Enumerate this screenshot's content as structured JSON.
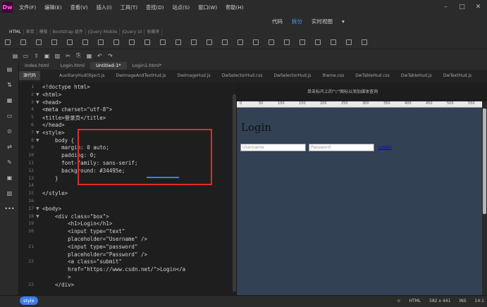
{
  "app": {
    "logo": "Dw"
  },
  "menu": [
    "文件(F)",
    "编辑(E)",
    "查看(V)",
    "插入(I)",
    "工具(T)",
    "查找(D)",
    "站点(S)",
    "窗口(W)",
    "帮助(H)"
  ],
  "views": {
    "code": "代码",
    "split": "拆分",
    "live": "实时视图",
    "dropdown": "▾"
  },
  "insert_tabs": [
    "HTML",
    "表单",
    "模板",
    "Bootstrap 组件",
    "jQuery Mobile",
    "jQuery UI",
    "收藏夹"
  ],
  "doc_tabs": [
    "index.html",
    "Login.html",
    "Untitled-1*",
    "Login1.html*"
  ],
  "source_button": "源代码",
  "related_files": [
    "AuxiliaryHudObject.js",
    "DwImageAndTextHud.js",
    "DwImageHud.js",
    "DwSelectorHud.css",
    "DwSelectorHud.js",
    "theme.css",
    "DwTableHud.css",
    "DwTableHud.js",
    "DwTextHud.js"
  ],
  "code_lines": [
    {
      "n": "1",
      "text": "<!doctype html>"
    },
    {
      "n": "2",
      "text": "<html>"
    },
    {
      "n": "3",
      "text": "<head>"
    },
    {
      "n": "4",
      "text": "<meta charset=\"utf-8\">"
    },
    {
      "n": "5",
      "text": "<title>登录页</title>"
    },
    {
      "n": "6",
      "text": "</head>"
    },
    {
      "n": "7",
      "text": "<style>"
    },
    {
      "n": "8",
      "text": "    body {"
    },
    {
      "n": "9",
      "text": "      margin: 0 auto;"
    },
    {
      "n": "10",
      "text": "      padding: 0;"
    },
    {
      "n": "11",
      "text": "      font-family: sans-serif;"
    },
    {
      "n": "12",
      "text": "      background: #34495e;"
    },
    {
      "n": "13",
      "text": "    }"
    },
    {
      "n": "14",
      "text": ""
    },
    {
      "n": "15",
      "text": "</style>"
    },
    {
      "n": "16",
      "text": ""
    },
    {
      "n": "17",
      "text": "<body>"
    },
    {
      "n": "18",
      "text": "    <div class=\"box\">"
    },
    {
      "n": "19",
      "text": "        <h1>Login</h1>"
    },
    {
      "n": "20",
      "text": "        <input type=\"text\""
    },
    {
      "n": "",
      "text": "        placeholder=\"Username\" />"
    },
    {
      "n": "21",
      "text": "        <input type=\"password\""
    },
    {
      "n": "",
      "text": "        placeholder=\"Password\" />"
    },
    {
      "n": "22",
      "text": "        <a class=\"submit\""
    },
    {
      "n": "",
      "text": "        href=\"https://www.csdn.net/\">Login</a"
    },
    {
      "n": "",
      "text": "        >"
    },
    {
      "n": "23",
      "text": "    </div>"
    }
  ],
  "live": {
    "hint": "单击标尺上的\"▽\"图标以添加媒体查询",
    "ruler_ticks": [
      "0",
      "50",
      "100",
      "150",
      "200",
      "250",
      "300",
      "350",
      "400",
      "450",
      "500",
      "550"
    ],
    "title": "Login",
    "username_placeholder": "Username",
    "password_placeholder": "Password",
    "link": "Login"
  },
  "status": {
    "tag": "style",
    "language": "HTML",
    "size": "582 x 441",
    "mode": "INS",
    "position": "14:1"
  }
}
